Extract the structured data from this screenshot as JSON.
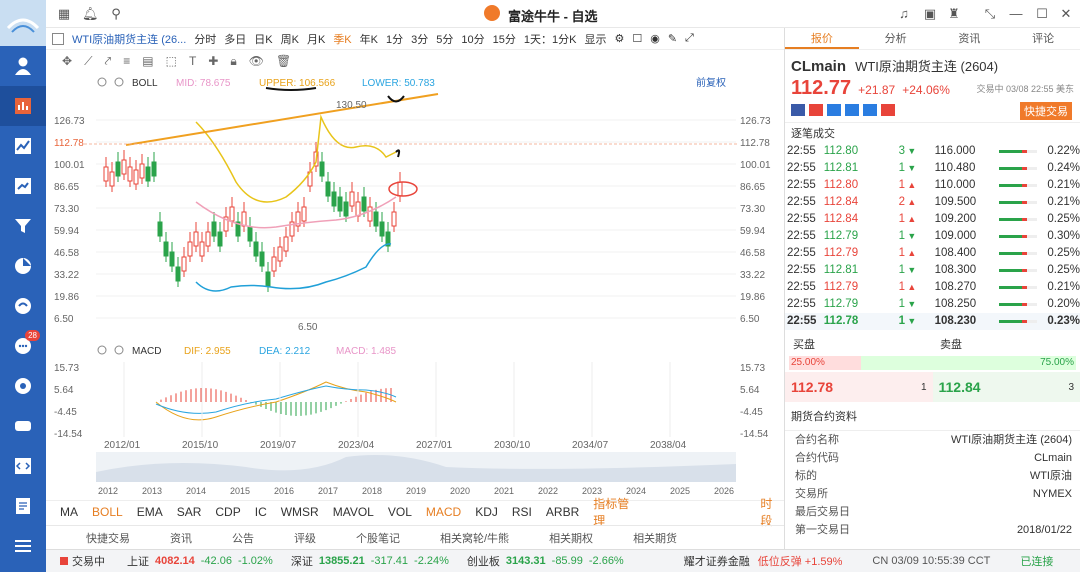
{
  "app": {
    "title": "富途牛牛 - 自选"
  },
  "sidebar": {
    "badge": "28"
  },
  "toolbar": {
    "symbol": "WTI原油期货主连 (26...",
    "periods": [
      "分时",
      "多日",
      "日K",
      "周K",
      "月K",
      "季K",
      "年K",
      "1分",
      "3分",
      "5分",
      "10分",
      "15分"
    ],
    "selected": "季K",
    "range": "1天：1分K",
    "display": "显示"
  },
  "indicator_boll": {
    "name": "BOLL",
    "mid": "MID: 78.675",
    "upper": "UPPER: 106.566",
    "lower": "LOWER: 50.783",
    "adjust": "前复权"
  },
  "price_axis": [
    "126.73",
    "112.78",
    "100.01",
    "86.65",
    "73.30",
    "59.94",
    "46.58",
    "33.22",
    "19.86",
    "6.50"
  ],
  "annotations": {
    "high": "130.50",
    "low": "6.50"
  },
  "indicator_macd": {
    "name": "MACD",
    "dif": "DIF: 2.955",
    "dea": "DEA: 2.212",
    "macd": "MACD: 1.485"
  },
  "macd_axis": [
    "15.73",
    "5.64",
    "-4.45",
    "-14.54"
  ],
  "time_axis": [
    "2012/01",
    "2015/10",
    "2019/07",
    "2023/04",
    "2027/01",
    "2030/10",
    "2034/07",
    "2038/04"
  ],
  "overview_axis": [
    "2012",
    "2013",
    "2014",
    "2015",
    "2016",
    "2017",
    "2018",
    "2019",
    "2020",
    "2021",
    "2022",
    "2023",
    "2024",
    "2025",
    "2026"
  ],
  "indicators": [
    "MA",
    "BOLL",
    "EMA",
    "SAR",
    "CDP",
    "IC",
    "WMSR",
    "MAVOL",
    "VOL",
    "MACD",
    "KDJ",
    "RSI",
    "ARBR"
  ],
  "indicator_mgmt": "指标管理",
  "timeshare": "时段",
  "subtabs": [
    "快捷交易",
    "资讯",
    "公告",
    "评级",
    "个股笔记",
    "相关窝轮/牛熊",
    "相关期权",
    "相关期货"
  ],
  "right_tabs": [
    "报价",
    "分析",
    "资讯",
    "评论"
  ],
  "quote": {
    "code": "CLmain",
    "name": "WTI原油期货主连 (2604)",
    "price": "112.77",
    "change": "+21.87",
    "change_pct": "+24.06%",
    "time": "交易中 03/08 22:55 美东",
    "quick_trade": "快捷交易"
  },
  "trades_title": "逐笔成交",
  "trades": [
    {
      "t": "22:55",
      "p": "112.80",
      "v": "3",
      "d": "dn",
      "p2": "116.000",
      "pct": "0.22%"
    },
    {
      "t": "22:55",
      "p": "112.81",
      "v": "1",
      "d": "dn",
      "p2": "110.480",
      "pct": "0.24%"
    },
    {
      "t": "22:55",
      "p": "112.80",
      "v": "1",
      "d": "up",
      "p2": "110.000",
      "pct": "0.21%"
    },
    {
      "t": "22:55",
      "p": "112.84",
      "v": "2",
      "d": "up",
      "p2": "109.500",
      "pct": "0.21%"
    },
    {
      "t": "22:55",
      "p": "112.84",
      "v": "1",
      "d": "up",
      "p2": "109.200",
      "pct": "0.25%"
    },
    {
      "t": "22:55",
      "p": "112.79",
      "v": "1",
      "d": "dn",
      "p2": "109.000",
      "pct": "0.30%"
    },
    {
      "t": "22:55",
      "p": "112.79",
      "v": "1",
      "d": "up",
      "p2": "108.400",
      "pct": "0.25%"
    },
    {
      "t": "22:55",
      "p": "112.81",
      "v": "1",
      "d": "dn",
      "p2": "108.300",
      "pct": "0.25%"
    },
    {
      "t": "22:55",
      "p": "112.79",
      "v": "1",
      "d": "up",
      "p2": "108.270",
      "pct": "0.21%"
    },
    {
      "t": "22:55",
      "p": "112.79",
      "v": "1",
      "d": "dn",
      "p2": "108.250",
      "pct": "0.20%"
    },
    {
      "t": "22:55",
      "p": "112.78",
      "v": "1",
      "d": "dn",
      "p2": "108.230",
      "pct": "0.23%"
    }
  ],
  "bid_ask": {
    "bid_label": "买盘",
    "ask_label": "卖盘",
    "bid_pct": "25.00%",
    "ask_pct": "75.00%",
    "bid_price": "112.78",
    "bid_vol": "1",
    "ask_price": "112.84",
    "ask_vol": "3"
  },
  "contract_title": "期货合约资料",
  "contract": [
    {
      "k": "合约名称",
      "v": "WTI原油期货主连 (2604)"
    },
    {
      "k": "合约代码",
      "v": "CLmain"
    },
    {
      "k": "标的",
      "v": "WTI原油"
    },
    {
      "k": "交易所",
      "v": "NYMEX"
    },
    {
      "k": "最后交易日",
      "v": ""
    },
    {
      "k": "第一交易日",
      "v": "2018/01/22"
    }
  ],
  "status": {
    "trading": "交易中",
    "sh": "上证",
    "sh_v": "4082.14",
    "sh_c": "-42.06",
    "sh_p": "-1.02%",
    "sz": "深证",
    "sz_v": "13855.21",
    "sz_c": "-317.41",
    "sz_p": "-2.24%",
    "cy": "创业板",
    "cy_v": "3143.31",
    "cy_c": "-85.99",
    "cy_p": "-2.66%",
    "broker": "耀才证券金融",
    "alert": "低位反弹 +1.59%",
    "clock": "CN 03/09 10:55:39 CCT",
    "conn": "已连接"
  }
}
